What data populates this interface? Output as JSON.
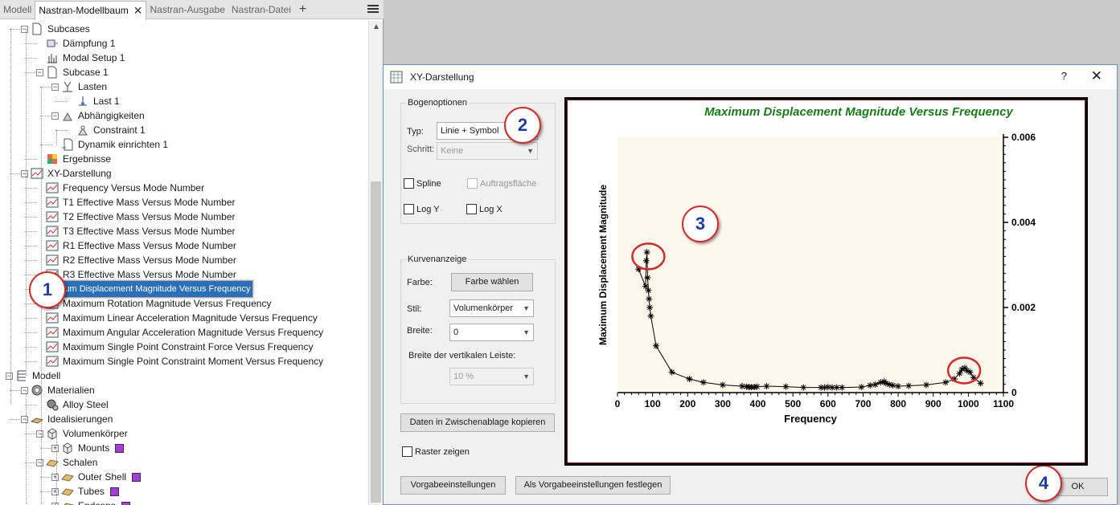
{
  "tabs": [
    {
      "label": "Modell"
    },
    {
      "label": "Nastran-Modellbaum",
      "active": true
    },
    {
      "label": "Nastran-Ausgabe"
    },
    {
      "label": "Nastran-Datei"
    }
  ],
  "tree": [
    {
      "label": "Subcases",
      "level": 2,
      "icon": "document-icon",
      "toggle": "-"
    },
    {
      "label": "Dämpfung 1",
      "level": 3,
      "icon": "damping-icon"
    },
    {
      "label": "Modal Setup 1",
      "level": 3,
      "icon": "modal-setup-icon"
    },
    {
      "label": "Subcase 1",
      "level": 3,
      "icon": "document-icon",
      "toggle": "-"
    },
    {
      "label": "Lasten",
      "level": 4,
      "icon": "loads-icon",
      "toggle": "-"
    },
    {
      "label": "Last 1",
      "level": 5,
      "icon": "load-icon"
    },
    {
      "label": "Abhängigkeiten",
      "level": 4,
      "icon": "constraints-icon",
      "toggle": "-"
    },
    {
      "label": "Constraint 1",
      "level": 5,
      "icon": "constraint-icon"
    },
    {
      "label": "Dynamik einrichten 1",
      "level": 4,
      "icon": "dynamics-icon"
    },
    {
      "label": "Ergebnisse",
      "level": 3,
      "icon": "results-icon"
    },
    {
      "label": "XY-Darstellung",
      "level": 2,
      "icon": "xy-plot-icon",
      "toggle": "-"
    },
    {
      "label": "Frequency Versus Mode Number",
      "level": 3,
      "icon": "xy-plot-icon"
    },
    {
      "label": "T1 Effective Mass Versus Mode Number",
      "level": 3,
      "icon": "xy-plot-icon"
    },
    {
      "label": "T2 Effective Mass Versus Mode Number",
      "level": 3,
      "icon": "xy-plot-icon"
    },
    {
      "label": "T3 Effective Mass Versus Mode Number",
      "level": 3,
      "icon": "xy-plot-icon"
    },
    {
      "label": "R1 Effective Mass Versus Mode Number",
      "level": 3,
      "icon": "xy-plot-icon"
    },
    {
      "label": "R2 Effective Mass Versus Mode Number",
      "level": 3,
      "icon": "xy-plot-icon"
    },
    {
      "label": "R3 Effective Mass Versus Mode Number",
      "level": 3,
      "icon": "xy-plot-icon"
    },
    {
      "label": "Maximum Displacement Magnitude Versus Frequency",
      "level": 3,
      "icon": "xy-plot-icon",
      "selected": true
    },
    {
      "label": "Maximum Rotation Magnitude Versus Frequency",
      "level": 3,
      "icon": "xy-plot-icon"
    },
    {
      "label": "Maximum Linear Acceleration Magnitude Versus Frequency",
      "level": 3,
      "icon": "xy-plot-icon"
    },
    {
      "label": "Maximum Angular Acceleration Magnitude Versus Frequency",
      "level": 3,
      "icon": "xy-plot-icon"
    },
    {
      "label": "Maximum Single Point Constraint Force Versus Frequency",
      "level": 3,
      "icon": "xy-plot-icon"
    },
    {
      "label": "Maximum Single Point Constraint Moment Versus Frequency",
      "level": 3,
      "icon": "xy-plot-icon"
    },
    {
      "label": "Modell",
      "level": 1,
      "icon": "model-icon",
      "toggle": "-"
    },
    {
      "label": "Materialien",
      "level": 2,
      "icon": "materials-icon",
      "toggle": "-"
    },
    {
      "label": "Alloy Steel",
      "level": 3,
      "icon": "material-icon"
    },
    {
      "label": "Idealisierungen",
      "level": 2,
      "icon": "idealization-icon",
      "toggle": "-"
    },
    {
      "label": "Volumenkörper",
      "level": 3,
      "icon": "solid-icon",
      "toggle": "-"
    },
    {
      "label": "Mounts",
      "level": 4,
      "icon": "solid-icon",
      "toggle": "+",
      "swatch": "#a43dd8"
    },
    {
      "label": "Schalen",
      "level": 3,
      "icon": "shell-icon",
      "toggle": "-"
    },
    {
      "label": "Outer Shell",
      "level": 4,
      "icon": "shell-icon",
      "toggle": "+",
      "swatch": "#a43dd8"
    },
    {
      "label": "Tubes",
      "level": 4,
      "icon": "shell-icon",
      "toggle": "+",
      "swatch": "#a43dd8"
    },
    {
      "label": "Endcaps",
      "level": 4,
      "icon": "shell-icon",
      "toggle": "+",
      "swatch": "#a43dd8"
    }
  ],
  "dialog": {
    "title": "XY-Darstellung",
    "help": "?",
    "close": "✕",
    "bogen": {
      "group_label": "Bogenoptionen",
      "typ_label": "Typ:",
      "typ_value": "Linie + Symbol",
      "schritt_label": "Schritt:",
      "schritt_value": "Keine",
      "spline": "Spline",
      "auftrag": "Auftragsfläche",
      "logy": "Log Y",
      "logx": "Log X"
    },
    "kurve": {
      "group_label": "Kurvenanzeige",
      "farbe_label": "Farbe:",
      "farbe_button": "Farbe wählen",
      "stil_label": "Stil:",
      "stil_value": "Volumenkörper",
      "breite_label": "Breite:",
      "breite_value": "0",
      "leiste_label": "Breite der vertikalen Leiste:",
      "leiste_value": "10 %"
    },
    "copy_button": "Daten in Zwischenablage kopieren",
    "raster": "Raster zeigen",
    "defaults_button": "Vorgabeeinstellungen",
    "set_defaults_button": "Als Vorgabeeinstellungen festlegen",
    "ok_button": "OK"
  },
  "callouts": [
    "1",
    "2",
    "3",
    "4"
  ],
  "colors": {
    "title": "#1a7a1a",
    "plot_bg": "#fdf8ec",
    "highlight_circle": "#d42a2a",
    "selection": "#2b6fb6",
    "swatch": "#a43dd8"
  },
  "chart_data": {
    "type": "line",
    "title": "Maximum Displacement Magnitude Versus Frequency",
    "xlabel": "Frequency",
    "ylabel": "Maximum Displacement Magnitude",
    "xlim": [
      0,
      1100
    ],
    "ylim": [
      0,
      0.006
    ],
    "xticks": [
      "0",
      "100",
      "200",
      "300",
      "400",
      "500",
      "600",
      "700",
      "800",
      "900",
      "1000",
      "1100"
    ],
    "yticks": [
      "0",
      "0.002",
      "0.004",
      "0.006"
    ],
    "y_axis_side": "right",
    "marker": "asterisk",
    "series": [
      {
        "x": [
          60,
          80,
          82,
          84,
          86,
          88,
          90,
          92,
          95,
          110,
          155,
          205,
          245,
          300,
          355,
          368,
          375,
          382,
          390,
          398,
          425,
          480,
          530,
          580,
          590,
          600,
          612,
          625,
          640,
          695,
          720,
          735,
          750,
          760,
          765,
          775,
          785,
          800,
          830,
          880,
          935,
          960,
          975,
          982,
          990,
          996,
          1005,
          1015,
          1035
        ],
        "y": [
          0.0029,
          0.0025,
          0.0031,
          0.0033,
          0.0027,
          0.0024,
          0.0022,
          0.002,
          0.0018,
          0.0011,
          0.00048,
          0.00032,
          0.00024,
          0.00018,
          0.00015,
          0.00014,
          0.00013,
          0.00013,
          0.00013,
          0.00014,
          0.00015,
          0.00014,
          0.00012,
          0.00012,
          0.00012,
          0.00013,
          0.00012,
          0.00012,
          0.00012,
          0.00013,
          0.00017,
          0.00019,
          0.00024,
          0.00026,
          0.00022,
          0.00019,
          0.00017,
          0.00015,
          0.00016,
          0.00018,
          0.00024,
          0.00032,
          0.00045,
          0.00055,
          0.00058,
          0.00052,
          0.00048,
          0.00035,
          0.00022
        ]
      }
    ],
    "highlights": [
      {
        "x": 88,
        "y": 0.0032
      },
      {
        "x": 988,
        "y": 0.00052
      }
    ]
  }
}
